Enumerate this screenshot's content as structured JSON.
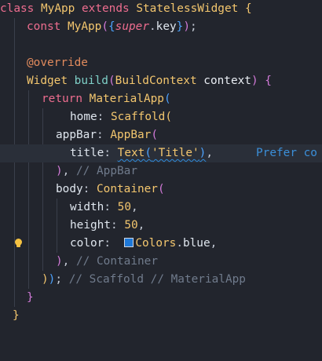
{
  "editor": {
    "lines": {
      "l1": {
        "kw1": "class",
        "cls1": "MyApp",
        "kw2": "extends",
        "cls2": "StatelessWidget",
        "br": "{"
      },
      "l2": {
        "kw": "const",
        "cls": "MyApp",
        "br1": "(",
        "br2": "{",
        "sup": "super",
        "dot": ".",
        "key": "key",
        "br3": "}",
        "br4": ")",
        "semi": ";"
      },
      "l4": {
        "ann": "@override"
      },
      "l5": {
        "cls": "Widget",
        "fn": "build",
        "br1": "(",
        "type": "BuildContext",
        "prm": "context",
        "br2": ")",
        "br3": "{"
      },
      "l6": {
        "kw": "return",
        "cls": "MaterialApp",
        "br": "("
      },
      "l7": {
        "prop": "home",
        "colon": ":",
        "cls": "Scaffold",
        "br": "("
      },
      "l8": {
        "prop": "appBar",
        "colon": ":",
        "cls": "AppBar",
        "br": "("
      },
      "l9": {
        "prop": "title",
        "colon": ":",
        "cls": "Text",
        "br1": "(",
        "str": "'Title'",
        "br2": ")",
        "comma": ",",
        "hint": "Prefer co"
      },
      "l10": {
        "br": ")",
        "comma": ",",
        "cmt": "// AppBar"
      },
      "l11": {
        "prop": "body",
        "colon": ":",
        "cls": "Container",
        "br": "("
      },
      "l12": {
        "prop": "width",
        "colon": ":",
        "num": "50",
        "comma": ","
      },
      "l13": {
        "prop": "height",
        "colon": ":",
        "num": "50",
        "comma": ","
      },
      "l14": {
        "prop": "color",
        "colon": ":",
        "cls": "Colors",
        "dot": ".",
        "val": "blue",
        "comma": ",",
        "swatch_color": "#1e78d8"
      },
      "l15": {
        "br": ")",
        "comma": ",",
        "cmt": "// Container"
      },
      "l16": {
        "br1": ")",
        "br2": ")",
        "semi": ";",
        "cmt": "// Scaffold // MaterialApp"
      },
      "l17": {
        "br": "}"
      },
      "l18": {
        "br": "}"
      }
    },
    "lightbulb_icon": "lightbulb-icon",
    "colors": {
      "background": "#22252d",
      "keyword": "#ee6d8f",
      "class": "#f3c66e",
      "function": "#7fd0c8",
      "comment": "#707b8c",
      "hint": "#3b8fd9",
      "annotation": "#e28b5d"
    }
  }
}
